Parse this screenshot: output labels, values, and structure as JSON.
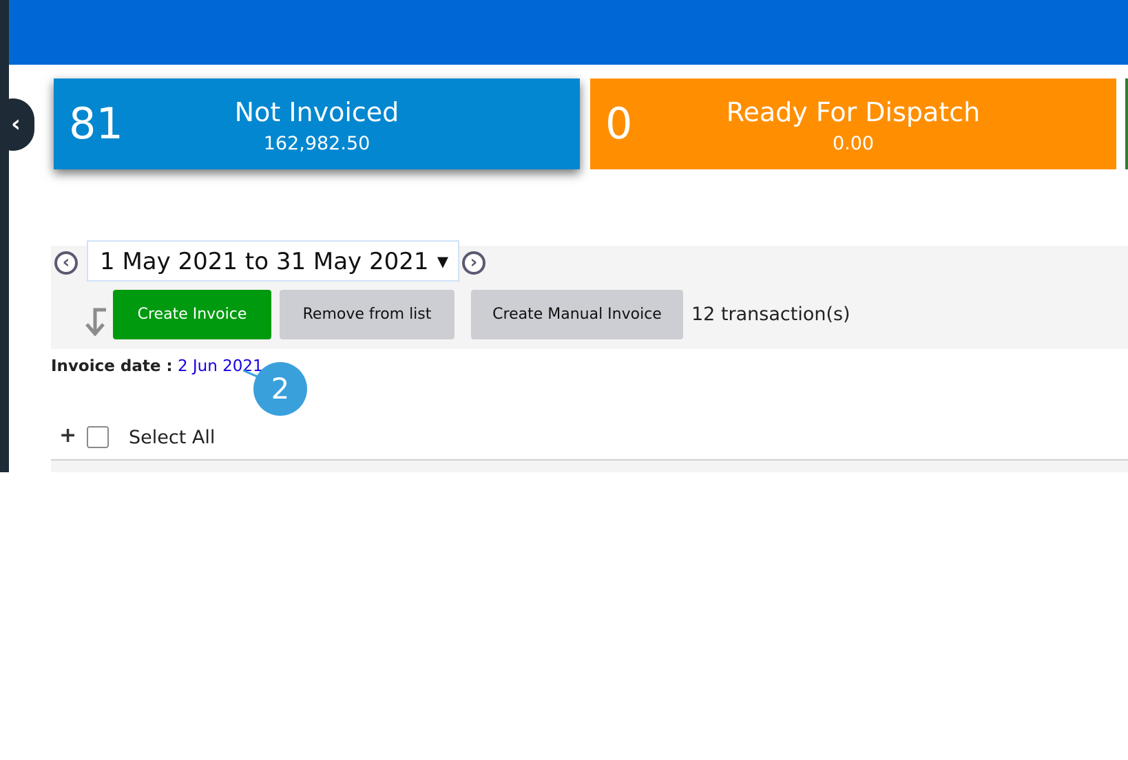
{
  "collapse_icon": "chevron-left-icon",
  "cards": [
    {
      "count": "81",
      "title": "Not Invoiced",
      "value": "162,982.50",
      "color": "#0387d0"
    },
    {
      "count": "0",
      "title": "Ready For Dispatch",
      "value": "0.00",
      "color": "#ff8f00"
    }
  ],
  "date_filter": {
    "range": "1 May 2021 to 31 May 2021",
    "prev_icon": "circle-chevron-left-icon",
    "next_icon": "circle-chevron-right-icon"
  },
  "actions": {
    "create_invoice": "Create Invoice",
    "remove_from_list": "Remove from list",
    "create_manual_invoice": "Create Manual Invoice",
    "transaction_count": "12 transaction(s)"
  },
  "invoice_date": {
    "label": "Invoice date :",
    "value": "2 Jun 2021"
  },
  "callout": {
    "number": "2",
    "color": "#3aa0dc"
  },
  "list": {
    "select_all": "Select All",
    "expand_symbol": "+"
  },
  "colors": {
    "topbar": "#0068d6",
    "create_button": "#009a0f",
    "link": "#1500e0"
  }
}
